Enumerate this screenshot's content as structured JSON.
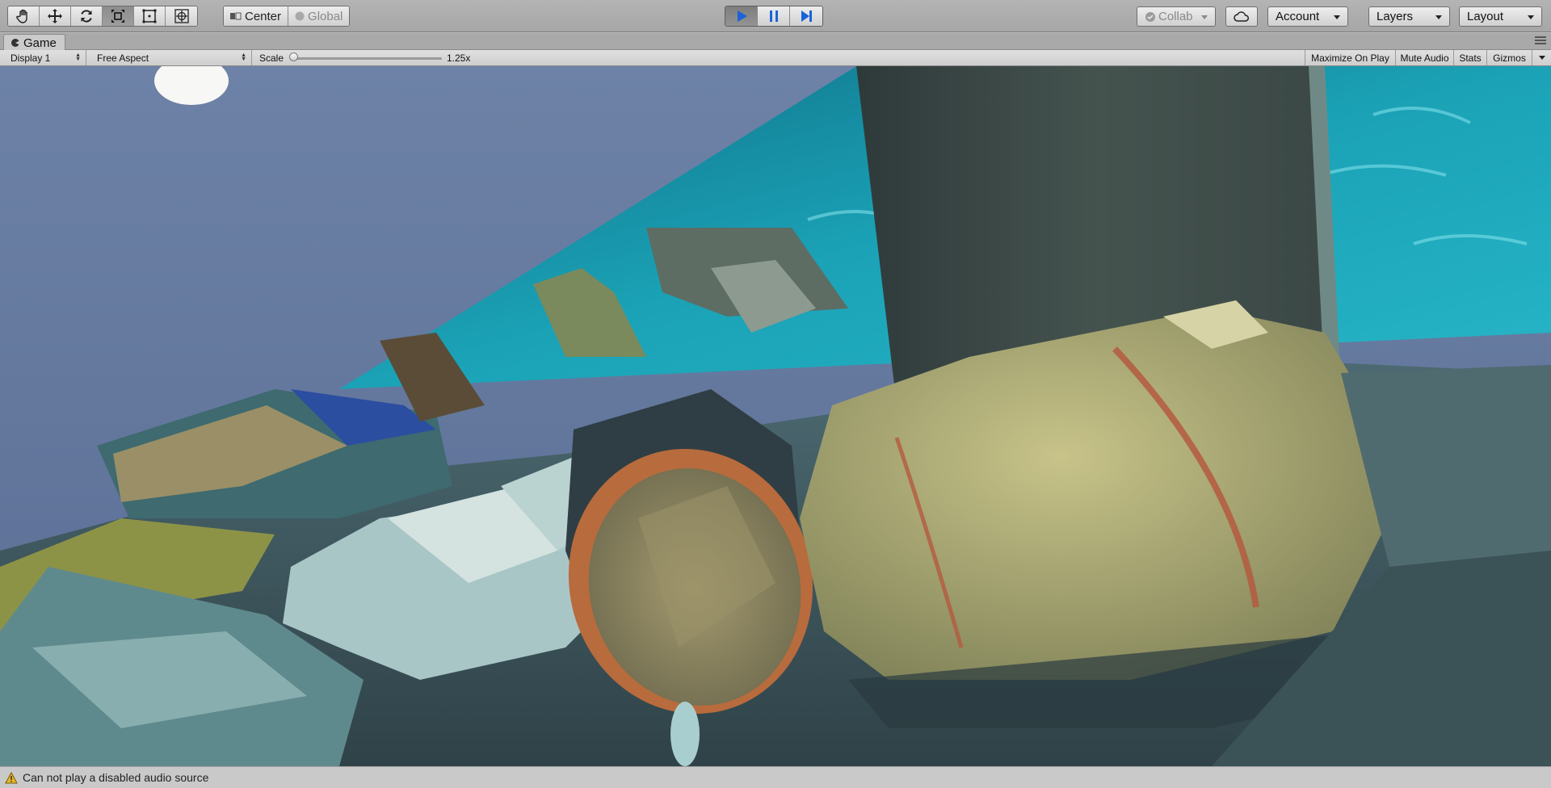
{
  "toolbar": {
    "tools": [
      {
        "name": "hand-tool",
        "icon": "hand-icon"
      },
      {
        "name": "move-tool",
        "icon": "move-icon"
      },
      {
        "name": "rotate-tool",
        "icon": "rotate-icon"
      },
      {
        "name": "scale-tool",
        "icon": "scale-icon",
        "active": true
      },
      {
        "name": "rect-tool",
        "icon": "rect-icon"
      },
      {
        "name": "transform-tool",
        "icon": "transform-icon"
      }
    ],
    "pivot_label": "Center",
    "global_label": "Global",
    "play_state": "playing",
    "collab_label": "Collab",
    "account_label": "Account",
    "layers_label": "Layers",
    "layout_label": "Layout"
  },
  "tab": {
    "title": "Game"
  },
  "gamebar": {
    "display": "Display 1",
    "aspect": "Free Aspect",
    "scale_label": "Scale",
    "scale_value": "1.25x",
    "scale_fraction": 0.0,
    "maximize_on_play": "Maximize On Play",
    "mute_audio": "Mute Audio",
    "stats": "Stats",
    "gizmos": "Gizmos"
  },
  "status": {
    "icon": "warning-icon",
    "message": "Can not play a disabled audio source"
  },
  "colors": {
    "play_blue": "#1a63d8",
    "sky": "#5a6f94",
    "ocean": "#1fa3b8"
  }
}
